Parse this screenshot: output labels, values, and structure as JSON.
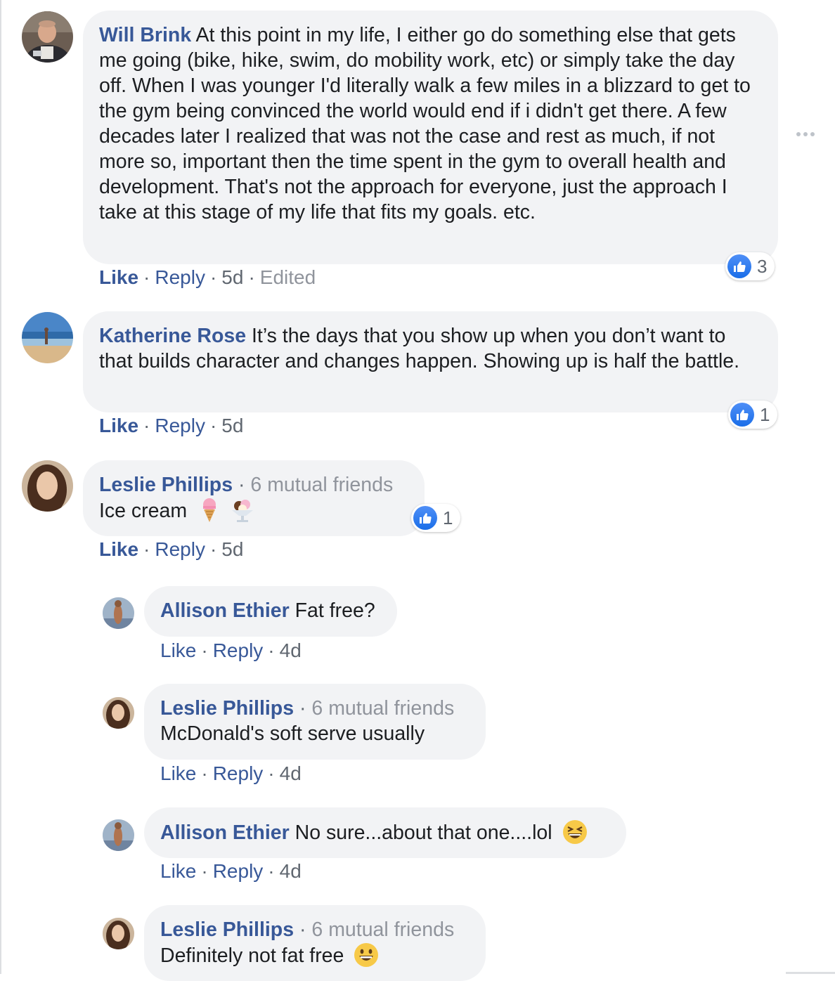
{
  "comments": [
    {
      "name": "Will Brink",
      "text": "At this point in my life, I either go do something else that gets me going (bike, hike, swim, do mobility work, etc) or simply take the day off. When I was younger I'd literally walk a few miles in a blizzard to get to the gym being convinced the world would end if i didn't get there. A few decades later I realized that was not the case and rest as much, if not more so, important then the time spent in the gym to overall health and development. That's not the approach for everyone, just the approach I take at this stage of my life that fits my goals. etc.",
      "like": "Like",
      "reply": "Reply",
      "time": "5d",
      "edited": "Edited",
      "reactions": "3"
    },
    {
      "name": "Katherine Rose",
      "text": "It’s the days that you show up when you don’t want to that builds character and changes happen. Showing up is half the battle.",
      "like": "Like",
      "reply": "Reply",
      "time": "5d",
      "reactions": "1"
    },
    {
      "name": "Leslie Phillips",
      "mutual": "6 mutual friends",
      "text": "Ice cream",
      "like": "Like",
      "reply": "Reply",
      "time": "5d",
      "reactions": "1"
    }
  ],
  "replies": [
    {
      "name": "Allison Ethier",
      "text": "Fat free?",
      "like": "Like",
      "reply": "Reply",
      "time": "4d"
    },
    {
      "name": "Leslie Phillips",
      "mutual": "6 mutual friends",
      "text": "McDonald's soft serve usually",
      "like": "Like",
      "reply": "Reply",
      "time": "4d"
    },
    {
      "name": "Allison Ethier",
      "text": "No sure...about that one....lol",
      "like": "Like",
      "reply": "Reply",
      "time": "4d"
    },
    {
      "name": "Leslie Phillips",
      "mutual": "6 mutual friends",
      "text": "Definitely not fat free"
    }
  ],
  "separator": "·",
  "icons": {
    "more": "more-horizontal-icon",
    "like_reaction": "thumbs-up-icon",
    "emoji_ice_cream": "ice-cream-cone-icon",
    "emoji_sundae": "ice-cream-sundae-icon",
    "emoji_laughing": "laughing-face-icon",
    "emoji_grinning": "grinning-face-icon"
  },
  "colors": {
    "name_link": "#385898",
    "bubble_bg": "#f2f3f5",
    "meta_text": "#606770",
    "muted_text": "#90949c",
    "reaction_blue": "#1a6ee8"
  }
}
